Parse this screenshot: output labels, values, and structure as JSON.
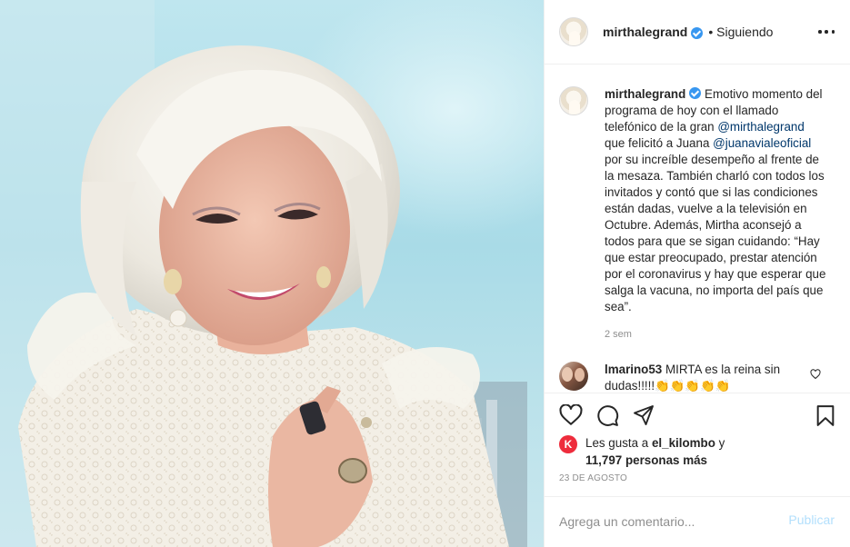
{
  "post": {
    "username": "mirthalegrand",
    "follow_status": "• Siguiendo",
    "image_alt": "Mirtha Legrand sonriendo y aplaudiendo en el estudio"
  },
  "caption": {
    "username": "mirthalegrand",
    "text_1": "Emotivo momento del programa de hoy con el llamado telefónico de la gran ",
    "mention_1": "@mirthalegrand",
    "text_2": " que felicitó a Juana ",
    "mention_2": "@juanavialeoficial",
    "text_3": " por su increíble desempeño al frente de la mesaza. También charló con todos los invitados y contó que si las condiciones están dadas, vuelve a la televisión en Octubre. Además, Mirtha aconsejó a todos para que se sigan cuidando: “Hay que estar preocupado, prestar atención por el coronavirus y hay que esperar que salga la vacuna, no importa del país que sea”.",
    "time": "2 sem"
  },
  "comment": {
    "username": "lmarino53",
    "text": "MIRTA es la reina sin dudas!!!!!👏👏👏👏👏"
  },
  "likes": {
    "avatar_letter": "K",
    "prefix": "Les gusta a ",
    "user": "el_kilombo",
    "connector": " y",
    "count": "11,797 personas más"
  },
  "date": "23 DE AGOSTO",
  "comment_box": {
    "placeholder": "Agrega un comentario...",
    "publish_label": "Publicar"
  },
  "icons": [
    "verified-badge-icon",
    "more-options-icon",
    "heart-icon",
    "comment-icon",
    "share-icon",
    "save-icon"
  ],
  "colors": {
    "verified": "#3897f0",
    "mention": "#00376b",
    "publish": "#b2dffc",
    "like_avatar": "#ee2c3c"
  }
}
